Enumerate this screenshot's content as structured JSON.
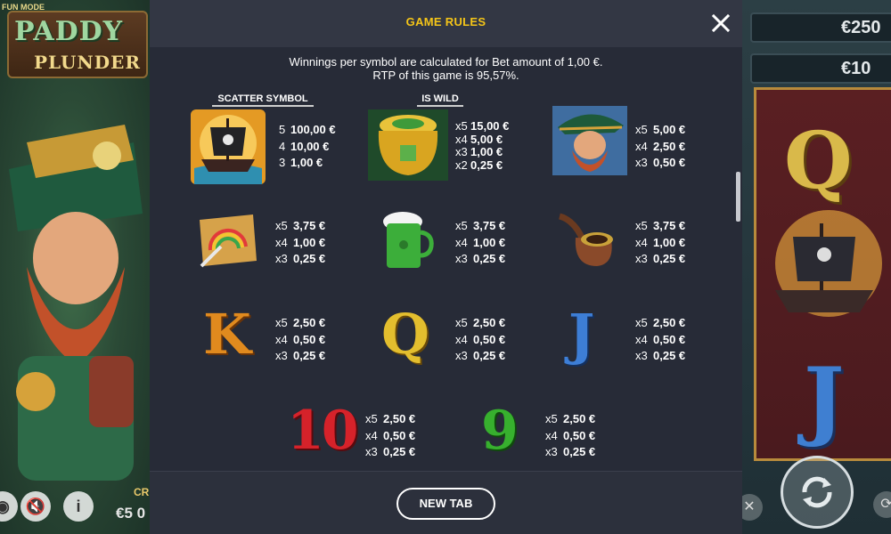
{
  "game": {
    "mode_label": "FUN MODE",
    "logo_line1": "PADDY",
    "logo_line2": "PLUNDER",
    "credit_label": "CR",
    "credit_value": "€5 0",
    "win_box_1": "€250",
    "win_box_2": "€10"
  },
  "modal": {
    "title": "GAME RULES",
    "intro_line1": "Winnings per symbol are calculated for Bet amount of 1,00 €.",
    "intro_line2": "RTP of this game is 95,57%.",
    "footer_button": "NEW TAB"
  },
  "symbols": [
    {
      "name": "pirate-ship",
      "heading": "SCATTER SYMBOL",
      "payouts": [
        {
          "mul": "5",
          "amount": "100,00 €"
        },
        {
          "mul": "4",
          "amount": "10,00 €"
        },
        {
          "mul": "3",
          "amount": "1,00 €"
        }
      ]
    },
    {
      "name": "pot-of-gold",
      "heading": "IS WILD",
      "payouts": [
        {
          "mul": "x5",
          "amount": "15,00 €"
        },
        {
          "mul": "x4",
          "amount": "5,00 €"
        },
        {
          "mul": "x3",
          "amount": "1,00 €"
        },
        {
          "mul": "x2",
          "amount": "0,25 €"
        }
      ]
    },
    {
      "name": "pirate-leprechaun",
      "payouts": [
        {
          "mul": "x5",
          "amount": "5,00 €"
        },
        {
          "mul": "x4",
          "amount": "2,50 €"
        },
        {
          "mul": "x3",
          "amount": "0,50 €"
        }
      ]
    },
    {
      "name": "rainbow-map",
      "payouts": [
        {
          "mul": "x5",
          "amount": "3,75 €"
        },
        {
          "mul": "x4",
          "amount": "1,00 €"
        },
        {
          "mul": "x3",
          "amount": "0,25 €"
        }
      ]
    },
    {
      "name": "green-beer",
      "payouts": [
        {
          "mul": "x5",
          "amount": "3,75 €"
        },
        {
          "mul": "x4",
          "amount": "1,00 €"
        },
        {
          "mul": "x3",
          "amount": "0,25 €"
        }
      ]
    },
    {
      "name": "pipe",
      "payouts": [
        {
          "mul": "x5",
          "amount": "3,75 €"
        },
        {
          "mul": "x4",
          "amount": "1,00 €"
        },
        {
          "mul": "x3",
          "amount": "0,25 €"
        }
      ]
    },
    {
      "name": "letter-k",
      "glyph": "K",
      "payouts": [
        {
          "mul": "x5",
          "amount": "2,50 €"
        },
        {
          "mul": "x4",
          "amount": "0,50 €"
        },
        {
          "mul": "x3",
          "amount": "0,25 €"
        }
      ]
    },
    {
      "name": "letter-q",
      "glyph": "Q",
      "payouts": [
        {
          "mul": "x5",
          "amount": "2,50 €"
        },
        {
          "mul": "x4",
          "amount": "0,50 €"
        },
        {
          "mul": "x3",
          "amount": "0,25 €"
        }
      ]
    },
    {
      "name": "letter-j",
      "glyph": "J",
      "payouts": [
        {
          "mul": "x5",
          "amount": "2,50 €"
        },
        {
          "mul": "x4",
          "amount": "0,50 €"
        },
        {
          "mul": "x3",
          "amount": "0,25 €"
        }
      ]
    },
    {
      "name": "number-10",
      "glyph": "10",
      "payouts": [
        {
          "mul": "x5",
          "amount": "2,50 €"
        },
        {
          "mul": "x4",
          "amount": "0,50 €"
        },
        {
          "mul": "x3",
          "amount": "0,25 €"
        }
      ]
    },
    {
      "name": "number-9",
      "glyph": "9",
      "payouts": [
        {
          "mul": "x5",
          "amount": "2,50 €"
        },
        {
          "mul": "x4",
          "amount": "0,50 €"
        },
        {
          "mul": "x3",
          "amount": "0,25 €"
        }
      ]
    }
  ],
  "colors": {
    "title_accent": "#f5c518",
    "modal_bg": "#272b37",
    "header_bg": "#333744"
  }
}
